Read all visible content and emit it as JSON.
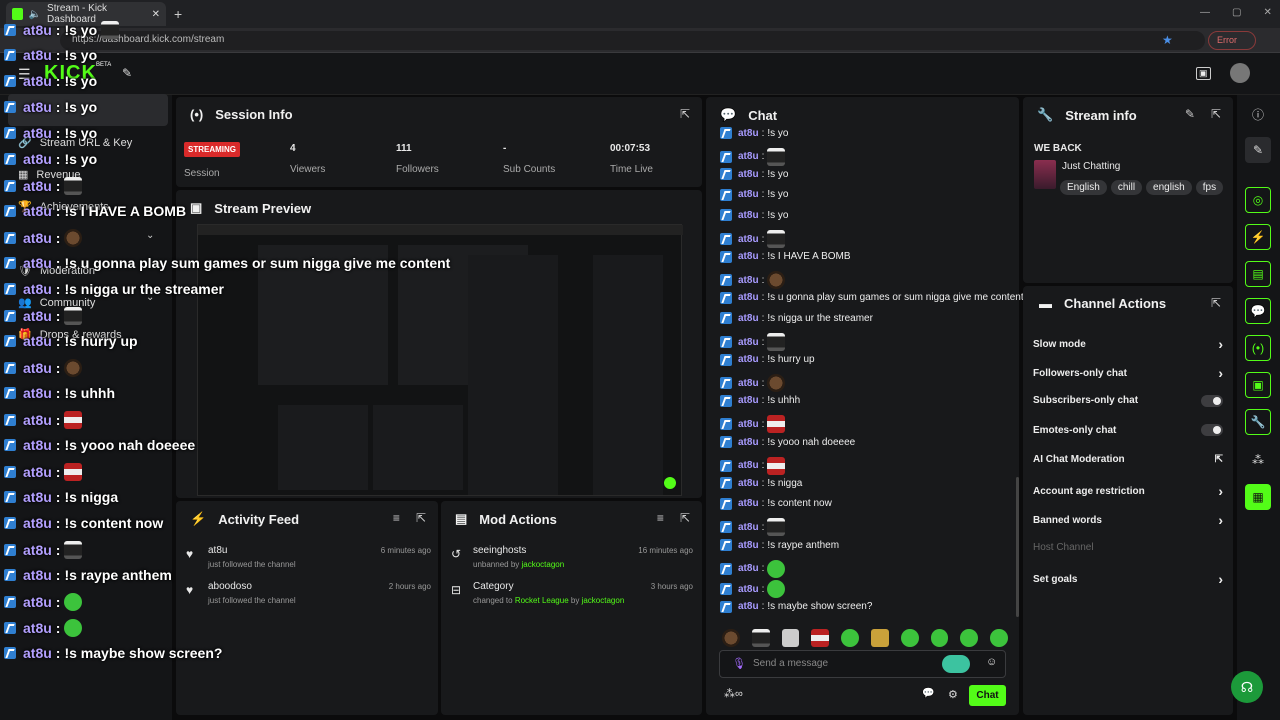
{
  "browser": {
    "tab_title": "Stream - Kick Dashboard",
    "url": "https://dashboard.kick.com/stream",
    "error_label": "Error"
  },
  "app": {
    "logo": "KICK",
    "beta": "BETA"
  },
  "leftnav": {
    "items": [
      "Stream URL & Key",
      "Revenue",
      "Achievements",
      "Drops & rewards",
      "Moderation",
      "Community"
    ]
  },
  "session": {
    "title": "Session Info",
    "status": "STREAMING",
    "status_label": "Session",
    "stats": [
      {
        "value": "4",
        "label": "Viewers"
      },
      {
        "value": "111",
        "label": "Followers"
      },
      {
        "value": "-",
        "label": "Sub Counts"
      },
      {
        "value": "00:07:53",
        "label": "Time Live"
      }
    ]
  },
  "preview": {
    "title": "Stream Preview"
  },
  "activity": {
    "title": "Activity Feed",
    "items": [
      {
        "name": "at8u",
        "desc": "just followed the channel",
        "time": "6 minutes ago"
      },
      {
        "name": "aboodoso",
        "desc": "just followed the channel",
        "time": "2 hours ago"
      }
    ]
  },
  "mod": {
    "title": "Mod Actions",
    "items": [
      {
        "name": "seeinghosts",
        "pre": "unbanned by",
        "by": "jackoctagon",
        "target": "",
        "mid": "",
        "time": "16 minutes ago"
      },
      {
        "name": "Category",
        "pre": "changed to",
        "target": "Rocket League",
        "mid": "by",
        "by": "jackoctagon",
        "time": "3 hours ago"
      }
    ]
  },
  "chat": {
    "title": "Chat",
    "placeholder": "Send a message",
    "send_label": "Chat",
    "username": "at8u",
    "messages": [
      {
        "text": "!s yo",
        "emote": ""
      },
      {
        "text": "",
        "emote": "man"
      },
      {
        "text": "!s yo",
        "emote": ""
      },
      {
        "text": "!s yo",
        "emote": ""
      },
      {
        "text": "!s yo",
        "emote": ""
      },
      {
        "text": "",
        "emote": "man"
      },
      {
        "text": "!s I HAVE A BOMB",
        "emote": ""
      },
      {
        "text": "",
        "emote": "cookie"
      },
      {
        "text": "!s u gonna play sum games or sum nigga give me content",
        "emote": ""
      },
      {
        "text": "!s nigga ur the streamer",
        "emote": ""
      },
      {
        "text": "",
        "emote": "man"
      },
      {
        "text": "!s hurry up",
        "emote": ""
      },
      {
        "text": "",
        "emote": "cookie"
      },
      {
        "text": "!s uhhh",
        "emote": ""
      },
      {
        "text": "",
        "emote": "flag"
      },
      {
        "text": "!s yooo nah doeeee",
        "emote": ""
      },
      {
        "text": "",
        "emote": "flag"
      },
      {
        "text": "!s nigga",
        "emote": ""
      },
      {
        "text": "!s content now",
        "emote": ""
      },
      {
        "text": "",
        "emote": "man"
      },
      {
        "text": "!s raype anthem",
        "emote": ""
      },
      {
        "text": "",
        "emote": "green"
      },
      {
        "text": "",
        "emote": "green"
      },
      {
        "text": "!s maybe show screen?",
        "emote": ""
      }
    ]
  },
  "overlay": {
    "messages": [
      {
        "text": "!s yo",
        "emote": "man"
      },
      {
        "text": "!s yo",
        "emote": ""
      },
      {
        "text": "!s yo",
        "emote": ""
      },
      {
        "text": "!s yo",
        "emote": ""
      },
      {
        "text": "!s yo",
        "emote": ""
      },
      {
        "text": "!s yo",
        "emote": ""
      },
      {
        "text": "",
        "emote": "man"
      },
      {
        "text": "!s I HAVE A BOMB",
        "emote": ""
      },
      {
        "text": "",
        "emote": "cookie"
      },
      {
        "text": "!s u gonna play sum games or sum nigga give me content",
        "emote": ""
      },
      {
        "text": "!s nigga ur the streamer",
        "emote": ""
      },
      {
        "text": "",
        "emote": "man"
      },
      {
        "text": "!s hurry up",
        "emote": ""
      },
      {
        "text": "",
        "emote": "cookie"
      },
      {
        "text": "!s uhhh",
        "emote": ""
      },
      {
        "text": "",
        "emote": "flag"
      },
      {
        "text": "!s yooo nah doeeee",
        "emote": ""
      },
      {
        "text": "",
        "emote": "flag"
      },
      {
        "text": "!s nigga",
        "emote": ""
      },
      {
        "text": "!s content now",
        "emote": ""
      },
      {
        "text": "",
        "emote": "man"
      },
      {
        "text": "!s raype anthem",
        "emote": ""
      },
      {
        "text": "",
        "emote": "green"
      },
      {
        "text": "",
        "emote": "green"
      },
      {
        "text": "!s maybe show screen?",
        "emote": ""
      }
    ]
  },
  "streaminfo": {
    "title": "Stream info",
    "stream_title": "WE BACK",
    "category": "Just Chatting",
    "tags": [
      "English",
      "chill",
      "english",
      "fps"
    ]
  },
  "channel_actions": {
    "title": "Channel Actions",
    "items": [
      {
        "label": "Slow mode",
        "control": "chevron"
      },
      {
        "label": "Followers-only chat",
        "control": "chevron"
      },
      {
        "label": "Subscribers-only chat",
        "control": "toggle"
      },
      {
        "label": "Emotes-only chat",
        "control": "toggle"
      },
      {
        "label": "AI Chat Moderation",
        "control": "external"
      },
      {
        "label": "Account age restriction",
        "control": "chevron"
      },
      {
        "label": "Banned words",
        "control": "chevron"
      },
      {
        "label": "Host Channel",
        "control": "disabled"
      },
      {
        "label": "Set goals",
        "control": "chevron"
      }
    ]
  },
  "colors": {
    "accent": "#53fc18",
    "streaming": "#d92a2a",
    "username": "#a89bff"
  }
}
